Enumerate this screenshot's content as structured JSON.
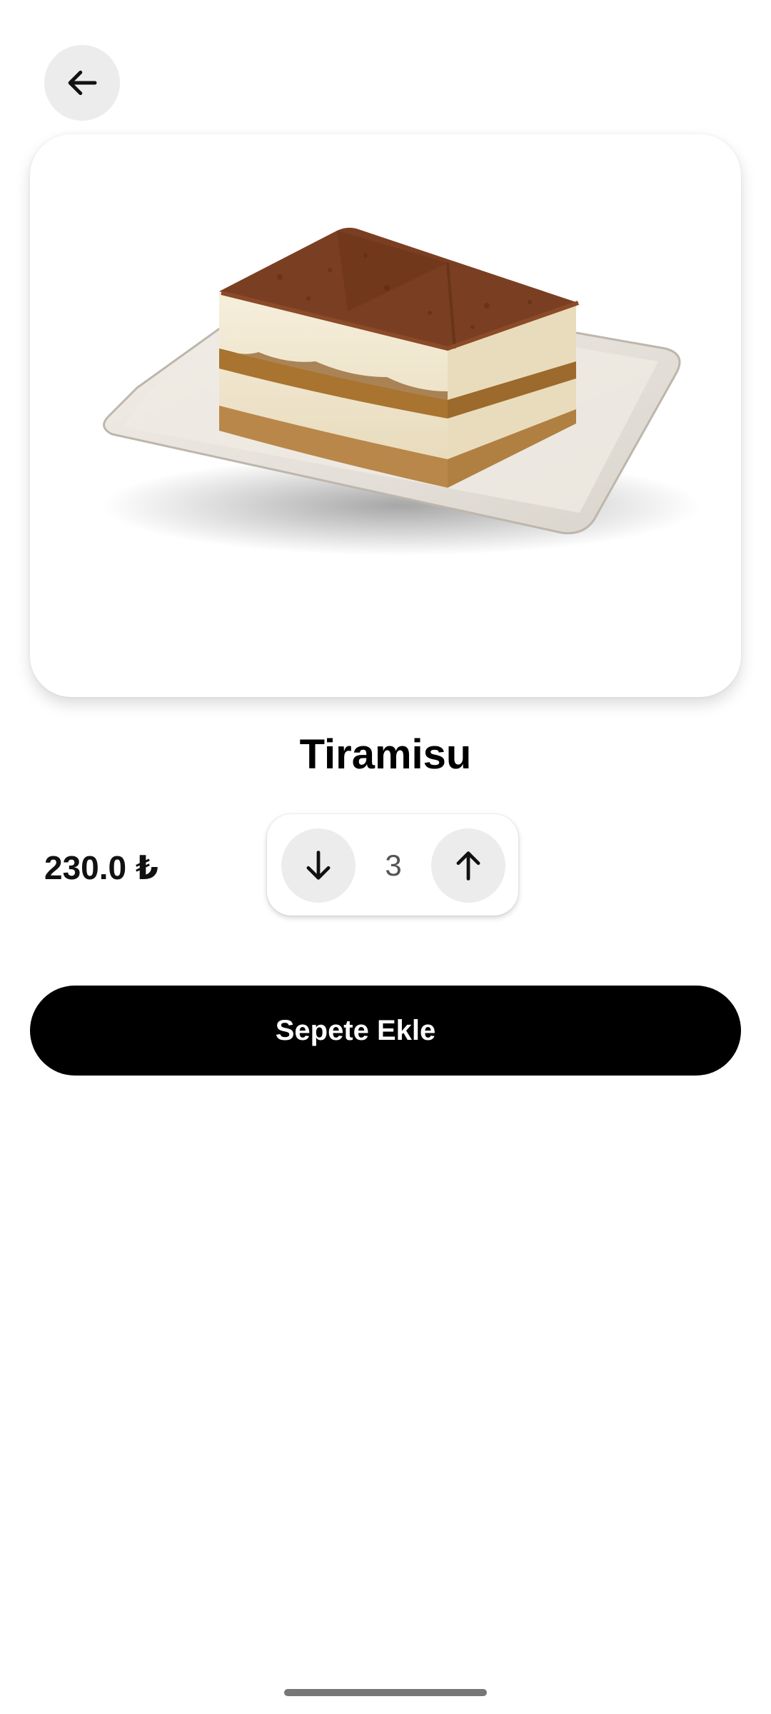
{
  "header": {
    "back_icon": "arrow-left-icon"
  },
  "product": {
    "image_alt": "tiramisu-on-plate",
    "name": "Tiramisu",
    "price": "230.0 ₺"
  },
  "quantity": {
    "decrease_icon": "arrow-down-icon",
    "value": "3",
    "increase_icon": "arrow-up-icon"
  },
  "actions": {
    "add_to_cart_label": "Sepete Ekle"
  },
  "colors": {
    "primary_button": "#000000",
    "button_text": "#ffffff",
    "icon_button_bg": "#ececec"
  }
}
